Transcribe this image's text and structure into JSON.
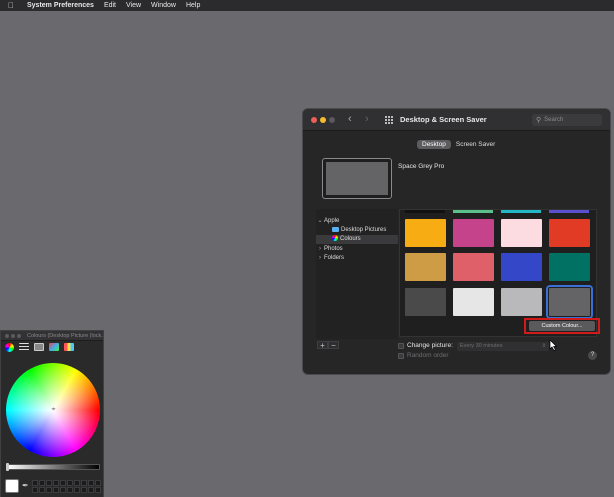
{
  "menubar": {
    "apple_icon": "apple-logo-icon",
    "items": [
      "System Preferences",
      "Edit",
      "View",
      "Window",
      "Help"
    ]
  },
  "window": {
    "title": "Desktop & Screen Saver",
    "search_placeholder": "Search",
    "tabs": [
      "Desktop",
      "Screen Saver"
    ],
    "active_tab": "Desktop",
    "picture_name": "Space Grey Pro",
    "sidebar": {
      "apple": "Apple",
      "desktop_pictures": "Desktop Pictures",
      "colours": "Colours",
      "photos": "Photos",
      "folders": "Folders"
    },
    "add_label": "+",
    "remove_label": "−",
    "custom_colour_button": "Custom Colour...",
    "change_picture_label": "Change picture:",
    "interval_value": "Every 30 minutes",
    "random_order_label": "Random order",
    "help_label": "?",
    "swatches": {
      "strip_colors": [
        "#111111",
        "#5bbf8a",
        "#22b8c8",
        "#5a4fcf"
      ],
      "colors": [
        "#f6ac12",
        "#c4438a",
        "#fcdbe1",
        "#e13a25",
        "#cf9c46",
        "#e0606a",
        "#3347c8",
        "#007162",
        "#4a4a4a",
        "#e6e6e6",
        "#b9b9bc",
        "#646467"
      ],
      "selected_index": 11
    }
  },
  "colour_panel": {
    "title": "Colours (Desktop Picture (lock...",
    "current_colour": "#ffffff"
  }
}
